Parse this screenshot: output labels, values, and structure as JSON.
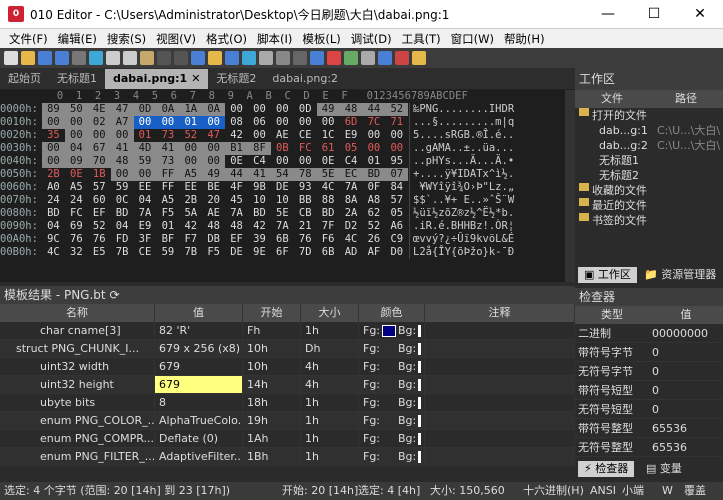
{
  "window": {
    "title": "010 Editor - C:\\Users\\Administrator\\Desktop\\今日刷题\\大白\\dabai.png:1",
    "minimize": "—",
    "maximize": "☐",
    "close": "✕"
  },
  "menu": [
    "文件(F)",
    "编辑(E)",
    "搜索(S)",
    "视图(V)",
    "格式(O)",
    "脚本(I)",
    "模板(L)",
    "调试(D)",
    "工具(T)",
    "窗口(W)",
    "帮助(H)"
  ],
  "tabs": [
    {
      "label": "起始页"
    },
    {
      "label": "无标题1"
    },
    {
      "label": "dabai.png:1",
      "active": true
    },
    {
      "label": "无标题2"
    },
    {
      "label": "dabai.png:2"
    }
  ],
  "hex": {
    "header": "         0  1  2  3  4  5  6  7  8  9  A  B  C  D  E  F   0123456789ABCDEF",
    "rows": [
      {
        "off": "0000h:",
        "b": [
          "89",
          "50",
          "4E",
          "47",
          "0D",
          "0A",
          "1A",
          "0A",
          "00",
          "00",
          "00",
          "0D",
          "49",
          "48",
          "44",
          "52"
        ],
        "a": "‰PNG........IHDR"
      },
      {
        "off": "0010h:",
        "b": [
          "00",
          "00",
          "02",
          "A7",
          "00",
          "00",
          "01",
          "00",
          "08",
          "06",
          "00",
          "00",
          "00",
          "6D",
          "7C",
          "71"
        ],
        "a": "...§.........m|q"
      },
      {
        "off": "0020h:",
        "b": [
          "35",
          "00",
          "00",
          "00",
          "01",
          "73",
          "52",
          "47",
          "42",
          "00",
          "AE",
          "CE",
          "1C",
          "E9",
          "00",
          "00"
        ],
        "a": "5....sRGB.®Î.é.."
      },
      {
        "off": "0030h:",
        "b": [
          "00",
          "04",
          "67",
          "41",
          "4D",
          "41",
          "00",
          "00",
          "B1",
          "8F",
          "0B",
          "FC",
          "61",
          "05",
          "00",
          "00"
        ],
        "a": "..gAMA..±..üa..."
      },
      {
        "off": "0040h:",
        "b": [
          "00",
          "09",
          "70",
          "48",
          "59",
          "73",
          "00",
          "00",
          "0E",
          "C4",
          "00",
          "00",
          "0E",
          "C4",
          "01",
          "95"
        ],
        "a": "..pHYs...Ä...Ä.•"
      },
      {
        "off": "0050h:",
        "b": [
          "2B",
          "0E",
          "1B",
          "00",
          "00",
          "FF",
          "A5",
          "49",
          "44",
          "41",
          "54",
          "78",
          "5E",
          "EC",
          "BD",
          "07"
        ],
        "a": "+....ÿ¥IDATx^ì½."
      },
      {
        "off": "0060h:",
        "b": [
          "A0",
          "A5",
          "57",
          "59",
          "EE",
          "FF",
          "EE",
          "BE",
          "4F",
          "9B",
          "DE",
          "93",
          "4C",
          "7A",
          "0F",
          "84"
        ],
        "a": " ¥WYîÿî¾O›Þ\"Lz.„"
      },
      {
        "off": "0070h:",
        "b": [
          "24",
          "24",
          "60",
          "0C",
          "04",
          "A5",
          "2B",
          "20",
          "45",
          "10",
          "10",
          "BB",
          "88",
          "8A",
          "A8",
          "57"
        ],
        "a": "$$`..¥+ E..»ˆŠ¨W"
      },
      {
        "off": "0080h:",
        "b": [
          "BD",
          "FC",
          "EF",
          "BD",
          "7A",
          "F5",
          "5A",
          "AE",
          "7A",
          "BD",
          "5E",
          "CB",
          "BD",
          "2A",
          "62",
          "05"
        ],
        "a": "½üï½zõZ®z½^Ë½*b."
      },
      {
        "off": "0090h:",
        "b": [
          "04",
          "69",
          "52",
          "04",
          "E9",
          "01",
          "42",
          "48",
          "48",
          "42",
          "7A",
          "21",
          "7F",
          "D2",
          "52",
          "A6"
        ],
        "a": ".iR.é.BHHBz!.ÒR¦"
      },
      {
        "off": "00A0h:",
        "b": [
          "9C",
          "76",
          "76",
          "FD",
          "3F",
          "BF",
          "F7",
          "DB",
          "EF",
          "39",
          "6B",
          "76",
          "F6",
          "4C",
          "26",
          "C9"
        ],
        "a": "œvvý?¿÷Ûï9kvöL&É"
      },
      {
        "off": "00B0h:",
        "b": [
          "4C",
          "32",
          "E5",
          "7B",
          "CE",
          "59",
          "7B",
          "F5",
          "DE",
          "9E",
          "6F",
          "7D",
          "6B",
          "AD",
          "AF",
          "D0"
        ],
        "a": "L2å{ÎY{õÞžo}k-¯Ð"
      }
    ]
  },
  "template_panel": {
    "title": "模板结果 - PNG.bt",
    "columns": [
      "名称",
      "值",
      "开始",
      "大小",
      "颜色",
      "注释"
    ],
    "rows": [
      {
        "name": "char cname[3]",
        "value": "82 'R'",
        "start": "Fh",
        "size": "1h",
        "fg": "Fg:",
        "bg": "Bg:",
        "indent": 3
      },
      {
        "name": "struct PNG_CHUNK_I...",
        "value": "679 x 256 (x8)",
        "start": "10h",
        "size": "Dh",
        "fg": "Fg:",
        "bg": "Bg:",
        "indent": 1,
        "expand": "⌄"
      },
      {
        "name": "uint32 width",
        "value": "679",
        "start": "10h",
        "size": "4h",
        "fg": "Fg:",
        "bg": "Bg:",
        "indent": 3
      },
      {
        "name": "uint32 height",
        "value": "679",
        "start": "14h",
        "size": "4h",
        "fg": "Fg:",
        "bg": "Bg:",
        "indent": 3,
        "selected": true
      },
      {
        "name": "ubyte bits",
        "value": "8",
        "start": "18h",
        "size": "1h",
        "fg": "Fg:",
        "bg": "Bg:",
        "indent": 3
      },
      {
        "name": "enum PNG_COLOR_...",
        "value": "AlphaTrueColo...",
        "start": "19h",
        "size": "1h",
        "fg": "Fg:",
        "bg": "Bg:",
        "indent": 3
      },
      {
        "name": "enum PNG_COMPR...",
        "value": "Deflate (0)",
        "start": "1Ah",
        "size": "1h",
        "fg": "Fg:",
        "bg": "Bg:",
        "indent": 3
      },
      {
        "name": "enum PNG_FILTER_...",
        "value": "AdaptiveFilter...",
        "start": "1Bh",
        "size": "1h",
        "fg": "Fg:",
        "bg": "Bg:",
        "indent": 3
      }
    ]
  },
  "workspace": {
    "title": "工作区",
    "columns": [
      "文件",
      "路径"
    ],
    "tree": [
      {
        "label": "打开的文件",
        "folder": true,
        "indent": 0
      },
      {
        "label": "dab...g:1",
        "path": "C:\\U...\\大白\\",
        "indent": 2
      },
      {
        "label": "dab...g:2",
        "path": "C:\\U...\\大白\\",
        "indent": 2
      },
      {
        "label": "无标题1",
        "indent": 2
      },
      {
        "label": "无标题2",
        "indent": 2
      },
      {
        "label": "收藏的文件",
        "folder": true,
        "indent": 0
      },
      {
        "label": "最近的文件",
        "folder": true,
        "indent": 0
      },
      {
        "label": "书签的文件",
        "folder": true,
        "indent": 0
      }
    ],
    "bottom_tabs": [
      "工作区",
      "资源管理器"
    ]
  },
  "inspector": {
    "title": "检查器",
    "columns": [
      "类型",
      "值"
    ],
    "rows": [
      {
        "type": "二进制",
        "value": "00000000"
      },
      {
        "type": "带符号字节",
        "value": "0"
      },
      {
        "type": "无符号字节",
        "value": "0"
      },
      {
        "type": "带符号短型",
        "value": "0"
      },
      {
        "type": "无符号短型",
        "value": "0"
      },
      {
        "type": "带符号整型",
        "value": "65536"
      },
      {
        "type": "无符号整型",
        "value": "65536"
      }
    ],
    "bottom_tabs": [
      "检查器",
      "变量"
    ]
  },
  "status": {
    "selected": "选定: 4 个字节 (范围: 20 [14h] 到 23 [17h])",
    "start": "开始: 20 [14h]",
    "sel": "选定: 4 [4h]",
    "size": "大小: 150,560",
    "mode": "十六进制(H)",
    "enc": "ANSI",
    "endian": "小端",
    "w": "W",
    "ovr": "覆盖"
  },
  "colors": {
    "accent_blue": "#1860c8",
    "selected_cell": "#ffff80",
    "fg_swatch": "#000080"
  }
}
